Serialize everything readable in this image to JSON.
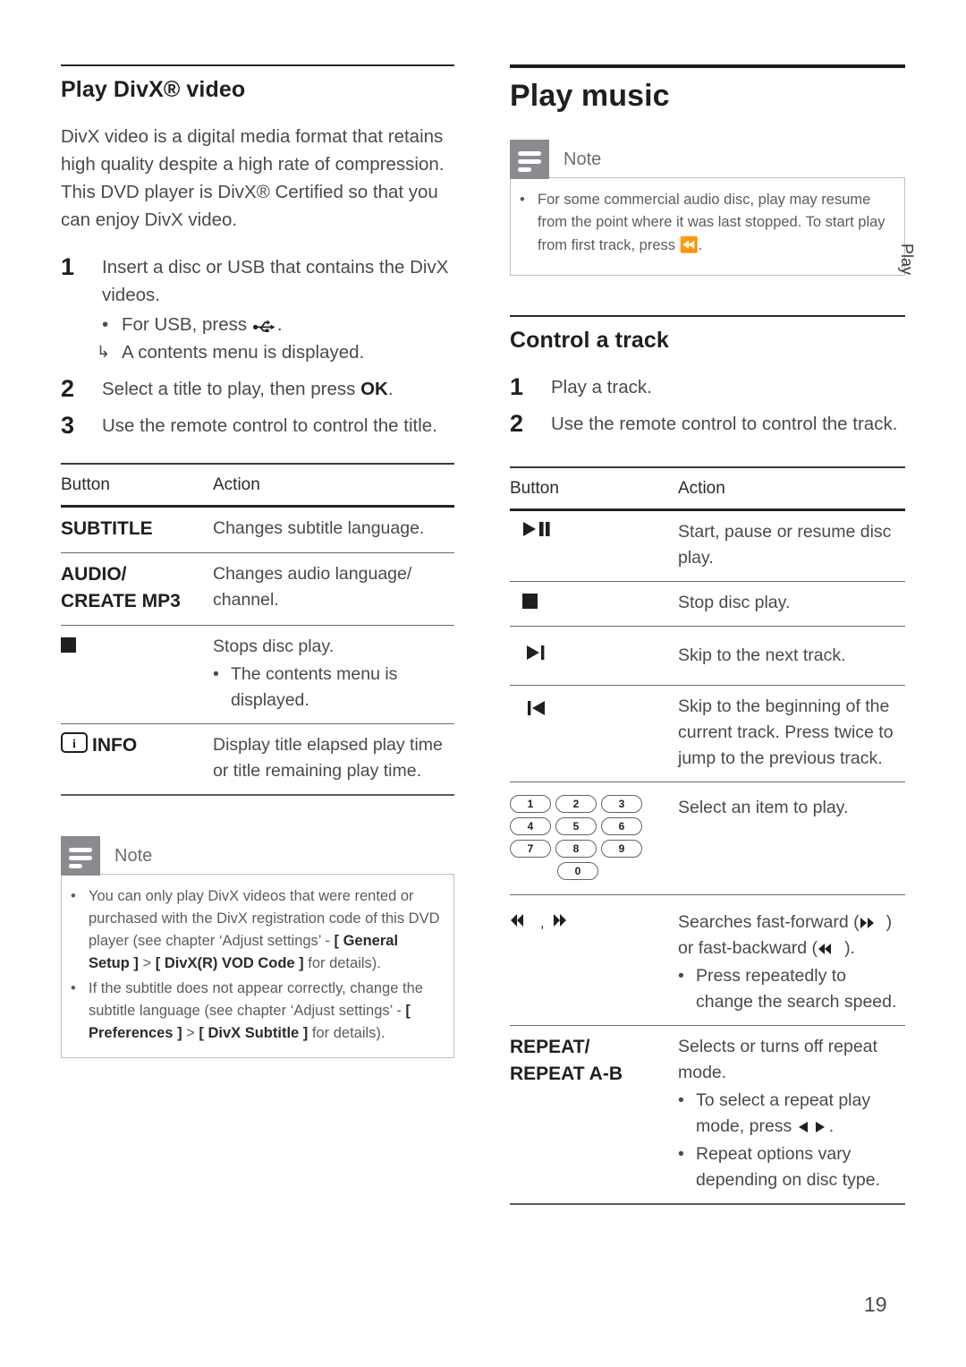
{
  "page": {
    "number": "19",
    "side_tab": "Play"
  },
  "left_column": {
    "section_title": "Play DivX® video",
    "intro_paragraph": "DivX video is a digital media format that retains high quality despite a high rate of compression. This DVD player is DivX® Certified so that you can enjoy DivX video.",
    "steps": [
      {
        "number": "1",
        "text": "Insert a disc or USB that contains the DivX videos.",
        "bullet": "For USB, press",
        "bullet_icon": "usb-icon",
        "bullet_suffix": ".",
        "arrow_text": "A contents menu is displayed.",
        "arrow_glyph": "↳"
      },
      {
        "number": "2",
        "text_before": "Select a title to play, then press ",
        "bold": "OK",
        "text_after": "."
      },
      {
        "number": "3",
        "text": "Use the remote control to control the title."
      }
    ],
    "table": {
      "header": {
        "button": "Button",
        "action": "Action"
      },
      "rows": [
        {
          "button_label": "SUBTITLE",
          "button_icon": "",
          "action": "Changes subtitle language.",
          "action_bullets": []
        },
        {
          "button_label": "AUDIO/\nCREATE MP3",
          "button_label_line1": "AUDIO/",
          "button_label_line2": "CREATE MP3",
          "button_icon": "",
          "action": "Changes audio language/ channel.",
          "action_bullets": []
        },
        {
          "button_label": "",
          "button_icon": "stop-icon",
          "action": "Stops disc play.",
          "action_bullets": [
            "The contents menu is displayed."
          ]
        },
        {
          "button_label": "INFO",
          "button_icon": "info-icon",
          "action": "Display title elapsed play time or title remaining play time.",
          "action_bullets": []
        }
      ]
    },
    "note": {
      "title": "Note",
      "icon": "note-icon",
      "items": [
        {
          "part1": "You can only play DivX videos that were rented or purchased with the DivX registration code of this DVD player (see chapter ‘Adjust settings’ - ",
          "bold1": "[ General Setup ]",
          "mid": " > ",
          "bold2": "[ DivX(R) VOD Code ]",
          "part2": " for details)."
        },
        {
          "part1": "If the subtitle does not appear correctly, change the subtitle language (see chapter ‘Adjust settings’ - ",
          "bold1": "[ Preferences ]",
          "mid": " > ",
          "bold2": "[ DivX Subtitle ]",
          "part2": " for details)."
        }
      ]
    }
  },
  "right_column": {
    "chapter_title": "Play music",
    "note": {
      "title": "Note",
      "icon": "note-icon",
      "items": [
        {
          "part1": "For some commercial audio disc, play may resume from the point where it was last stopped. To start play from first track, press ",
          "icon": "skip-previous-icon",
          "part2": "."
        }
      ]
    },
    "section_title": "Control a track",
    "steps": [
      {
        "number": "1",
        "text": "Play a track."
      },
      {
        "number": "2",
        "text": "Use the remote control to control the track."
      }
    ],
    "table": {
      "header": {
        "button": "Button",
        "action": "Action"
      },
      "rows": [
        {
          "button_icon": "play-pause-icon",
          "button_label": "",
          "action": "Start, pause or resume disc play.",
          "action_bullets": []
        },
        {
          "button_icon": "stop-icon",
          "button_label": "",
          "action": "Stop disc play.",
          "action_bullets": []
        },
        {
          "button_icon": "skip-next-icon",
          "button_label": "",
          "action": "Skip to the next track.",
          "action_bullets": []
        },
        {
          "button_icon": "skip-previous-icon",
          "button_label": "",
          "action": "Skip to the beginning of the current track. Press twice to jump to the previous track.",
          "action_bullets": []
        },
        {
          "button_icon": "number-keypad-icon",
          "button_label": "",
          "keypad": [
            "1",
            "2",
            "3",
            "4",
            "5",
            "6",
            "7",
            "8",
            "9",
            "0"
          ],
          "action": "Select an item to play.",
          "action_bullets": []
        },
        {
          "button_icon": "fast-backward-forward-icon",
          "button_label": "",
          "action_part1": "Searches fast-forward (",
          "action_icon1": "fast-forward-icon",
          "action_part2": ") or fast-backward (",
          "action_icon2": "fast-backward-icon",
          "action_part3": ").",
          "action_bullets": [
            "Press repeatedly to change the search speed."
          ]
        },
        {
          "button_label_line1": "REPEAT/",
          "button_label_line2": "REPEAT A-B",
          "button_icon": "",
          "action": "Selects or turns off repeat mode.",
          "action_bullets_rich": [
            {
              "part1": "To select a repeat play mode, press ",
              "icon1": "left-arrow-icon",
              "icon2": "right-arrow-icon",
              "part2": "."
            },
            {
              "part1": "Repeat options vary depending on disc type.",
              "icon1": "",
              "icon2": "",
              "part2": ""
            }
          ]
        }
      ]
    }
  },
  "colors": {
    "text": "#4a4a4a",
    "heading": "#1f1f1f",
    "note_icon_bg": "#8a8a8f",
    "note_border": "#b9c3c7",
    "rule": "#3a3a3a"
  }
}
